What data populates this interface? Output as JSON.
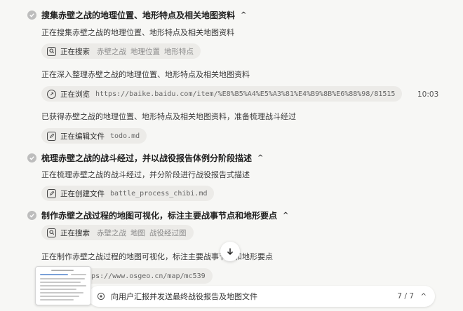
{
  "sections": [
    {
      "title": "搜集赤壁之战的地理位置、地形特点及相关地图资料",
      "steps": [
        {
          "desc": "正在搜集赤壁之战的地理位置、地形特点及相关地图资料",
          "tool": {
            "action": "正在搜索",
            "keywords": [
              "赤壁之战",
              "地理位置",
              "地形特点"
            ]
          }
        },
        {
          "desc": "正在深入整理赤壁之战的地理位置、地形特点及相关地图资料",
          "tool": {
            "action": "正在浏览",
            "arg": "https://baike.baidu.com/item/%E8%B5%A4%E5%A3%81%E4%B9%8B%E6%88%98/81515",
            "time": "10:03"
          }
        },
        {
          "desc": "已获得赤壁之战的地理位置、地形特点及相关地图资料，准备梳理战斗经过",
          "tool": {
            "action": "正在编辑文件",
            "arg": "todo.md"
          }
        }
      ]
    },
    {
      "title": "梳理赤壁之战的战斗经过，并以战役报告体例分阶段描述",
      "steps": [
        {
          "desc": "正在梳理赤壁之战的战斗经过，并分阶段进行战役报告式描述",
          "tool": {
            "action": "正在创建文件",
            "arg": "battle_process_chibi.md"
          }
        }
      ]
    },
    {
      "title": "制作赤壁之战过程的地图可视化，标注主要战事节点和地形要点",
      "steps": [
        {
          "tool": {
            "action": "正在搜索",
            "keywords": [
              "赤壁之战",
              "地图",
              "战役经过图"
            ]
          }
        },
        {
          "desc": "正在制作赤壁之战过程的地图可视化，标注主要战事节点和地形要点",
          "tool": {
            "action": "",
            "arg": "https://www.osgeo.cn/map/mc539"
          }
        }
      ]
    }
  ],
  "bottom": {
    "status": "向用户汇报并发送最终战役报告及地图文件",
    "progress": "7 / 7"
  },
  "icons": {
    "check": "check-icon",
    "search": "search-icon",
    "browse": "browser-icon",
    "edit": "edit-icon",
    "scroll": "arrow-down-icon"
  },
  "colors": {
    "background": "#f7f7f5",
    "chip": "#ecebe8",
    "check": "#bdbdbd"
  }
}
